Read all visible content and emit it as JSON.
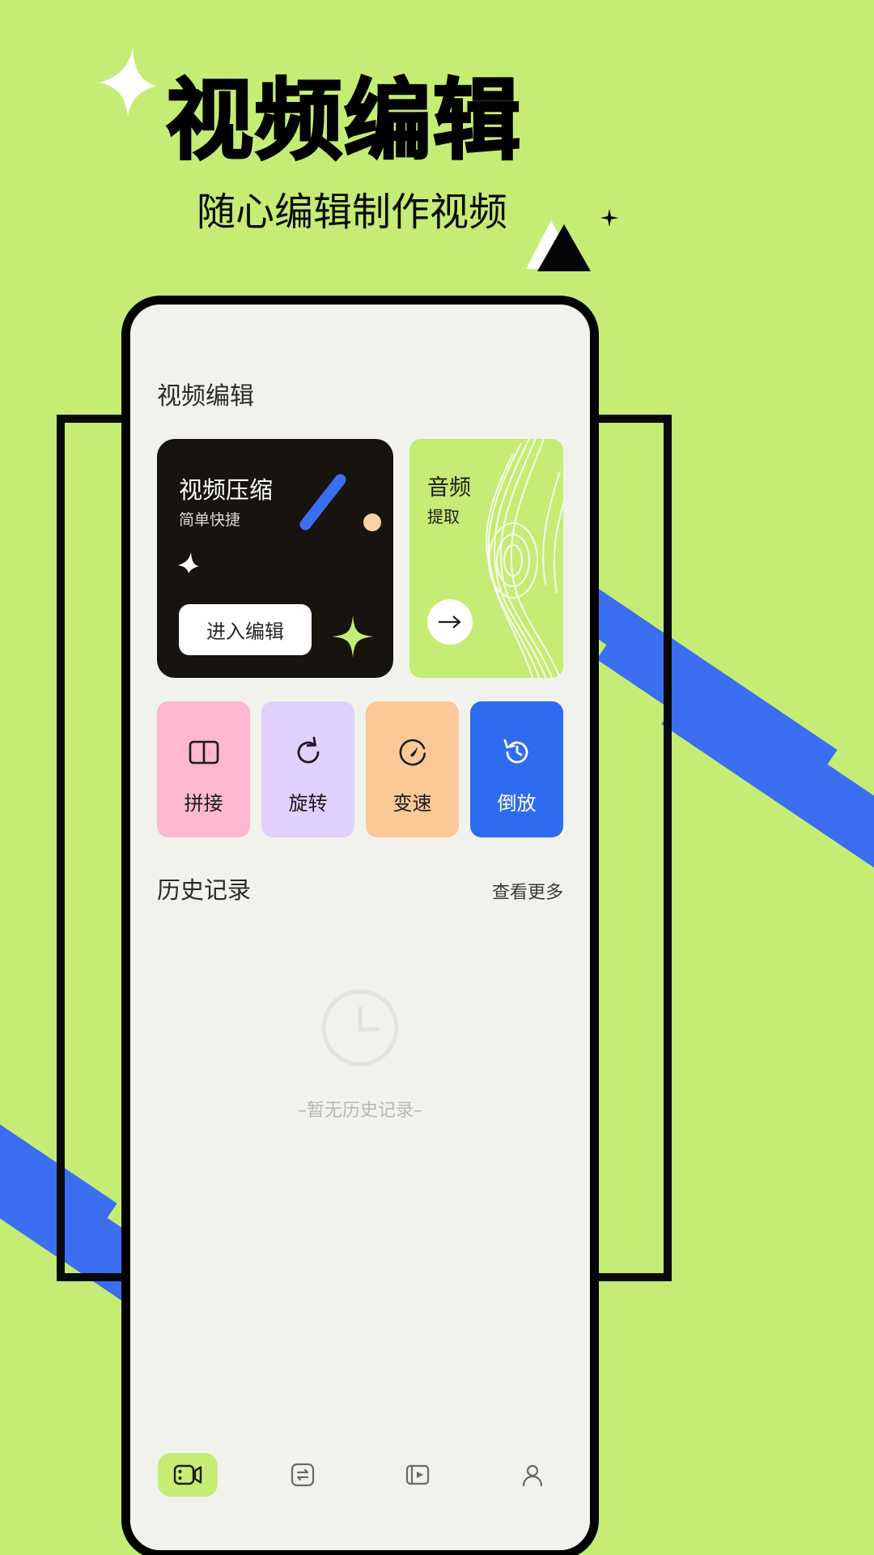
{
  "theme": {
    "bg_green": "#c5ec74",
    "accent_blue": "#3b6ef0",
    "ink": "#17140f",
    "screen_bg": "#f2f2ed",
    "pink": "#fbb8d0",
    "lavender": "#e0d0fb",
    "peach": "#fbc998",
    "blue": "#2f6bf0"
  },
  "hero": {
    "title": "视频编辑",
    "subtitle": "随心编辑制作视频",
    "star_icon": "four-point-star-icon",
    "triangle_white_icon": "triangle-white-icon",
    "triangle_black_icon": "triangle-black-icon"
  },
  "screen": {
    "title": "视频编辑",
    "featured": {
      "primary": {
        "title": "视频压缩",
        "subtitle": "简单快捷",
        "button_label": "进入编辑",
        "stroke_icon": "diagonal-stroke-icon",
        "dot_icon": "dot-icon",
        "star_icon": "four-point-star-icon",
        "diamond_icon": "four-point-diamond-icon"
      },
      "secondary": {
        "title": "音频",
        "subtitle": "提取",
        "arrow_icon": "arrow-right-icon"
      }
    },
    "tools": [
      {
        "label": "拼接",
        "icon": "split-columns-icon",
        "bg": "#fbb8d0",
        "active": false
      },
      {
        "label": "旋转",
        "icon": "rotate-icon",
        "bg": "#e0d0fb",
        "active": false
      },
      {
        "label": "变速",
        "icon": "speed-gauge-icon",
        "bg": "#fbc998",
        "active": false
      },
      {
        "label": "倒放",
        "icon": "history-reverse-icon",
        "bg": "#2f6bf0",
        "active": true
      }
    ],
    "history": {
      "title": "历史记录",
      "more_label": "查看更多",
      "empty_text": "–暂无历史记录–",
      "empty_icon": "clock-icon"
    },
    "nav": [
      {
        "icon": "video-editor-icon",
        "active": true
      },
      {
        "icon": "transfer-icon",
        "active": false
      },
      {
        "icon": "media-play-icon",
        "active": false
      },
      {
        "icon": "person-icon",
        "active": false
      }
    ]
  }
}
